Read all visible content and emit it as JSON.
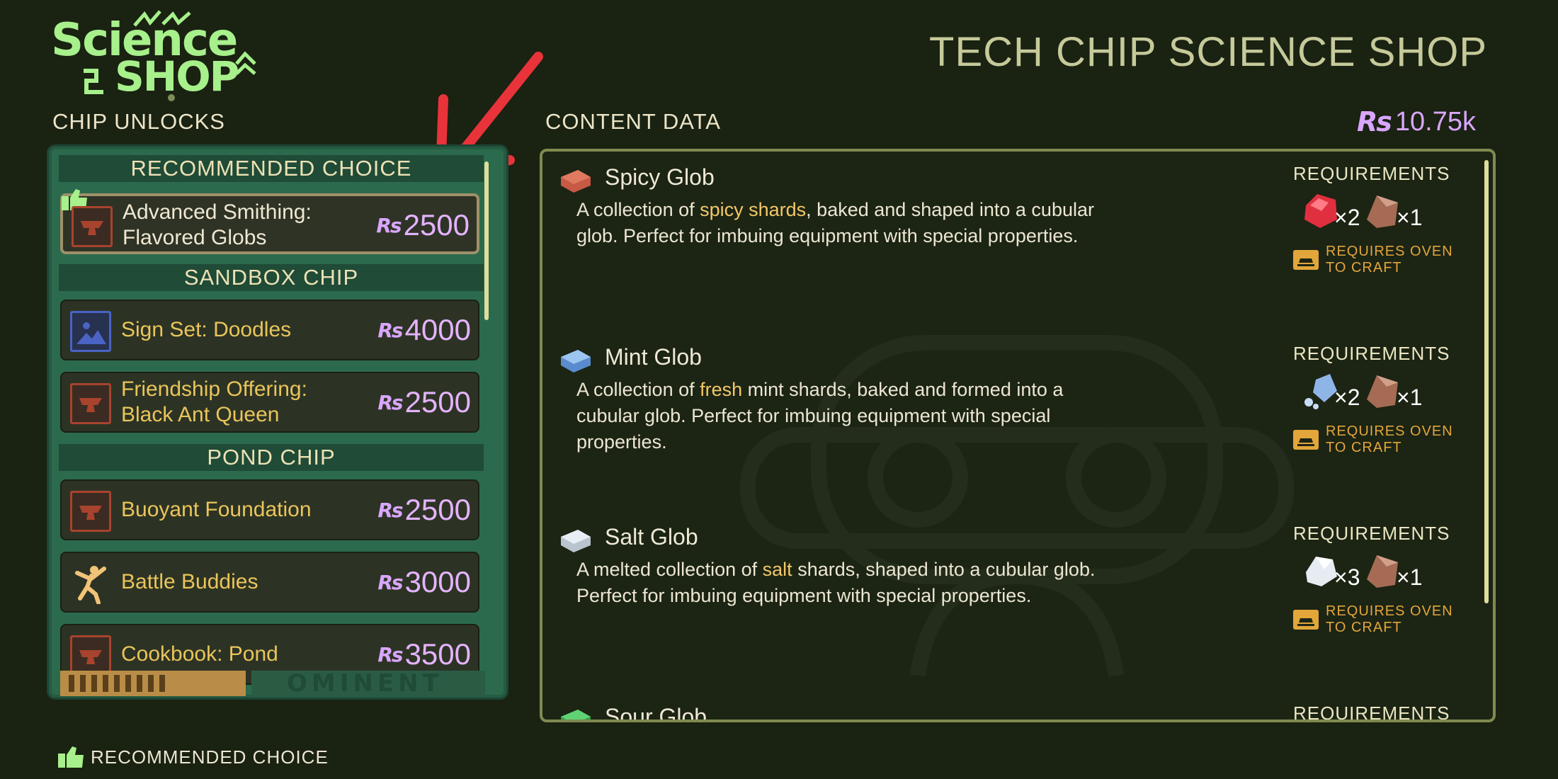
{
  "logo": {
    "line1": "Science",
    "line2": "SHOP"
  },
  "header": {
    "title": "TECH CHIP SCIENCE SHOP"
  },
  "left": {
    "heading": "CHIP UNLOCKS",
    "categories": {
      "recommended": "RECOMMENDED CHOICE",
      "sandbox": "SANDBOX CHIP",
      "pond": "POND CHIP"
    },
    "items": [
      {
        "name": "Advanced Smithing: Flavored Globs",
        "price": "2500",
        "icon": "anvil-icon",
        "selected": true,
        "recommended": true
      },
      {
        "name": "Sign Set: Doodles",
        "price": "4000",
        "icon": "image-icon"
      },
      {
        "name": "Friendship Offering: Black Ant Queen",
        "price": "2500",
        "icon": "anvil-icon"
      },
      {
        "name": "Buoyant Foundation",
        "price": "2500",
        "icon": "anvil-icon"
      },
      {
        "name": "Battle Buddies",
        "price": "3000",
        "icon": "dancing-figure-icon"
      },
      {
        "name": "Cookbook: Pond",
        "price": "3500",
        "icon": "anvil-icon"
      }
    ],
    "footer_logo": "OMINENT"
  },
  "right": {
    "heading": "CONTENT DATA",
    "balance": "10.75k",
    "currency_symbol": "Rs",
    "requirements_label": "REQUIREMENTS",
    "oven_note": "REQUIRES OVEN TO CRAFT",
    "items": [
      {
        "name": "Spicy Glob",
        "desc": [
          "A collection of ",
          "spicy shards",
          ", baked and shaped into a cubular glob. Perfect for imbuing equipment with special properties."
        ],
        "req": [
          {
            "icon": "red-shard-icon",
            "qty": "×2"
          },
          {
            "icon": "sap-chunk-icon",
            "qty": "×1"
          }
        ]
      },
      {
        "name": "Mint Glob",
        "desc": [
          "A collection of ",
          "fresh",
          " mint shards, baked and formed into a cubular glob. Perfect for imbuing equipment with special properties."
        ],
        "req": [
          {
            "icon": "mint-shard-icon",
            "qty": "×2"
          },
          {
            "icon": "sap-chunk-icon",
            "qty": "×1"
          }
        ]
      },
      {
        "name": "Salt Glob",
        "desc": [
          "A melted collection of ",
          "salt",
          " shards, shaped into a cubular glob. Perfect for imbuing equipment with special properties."
        ],
        "req": [
          {
            "icon": "salt-crystal-icon",
            "qty": "×3"
          },
          {
            "icon": "sap-chunk-icon",
            "qty": "×1"
          }
        ]
      },
      {
        "name": "Sour Glob"
      }
    ]
  },
  "legend": {
    "text": "RECOMMENDED CHOICE"
  },
  "colors": {
    "accent": "#a7f08b",
    "price": "#e4b3ff",
    "highlight": "#f3c867",
    "panel_green": "#2c6a4d"
  }
}
